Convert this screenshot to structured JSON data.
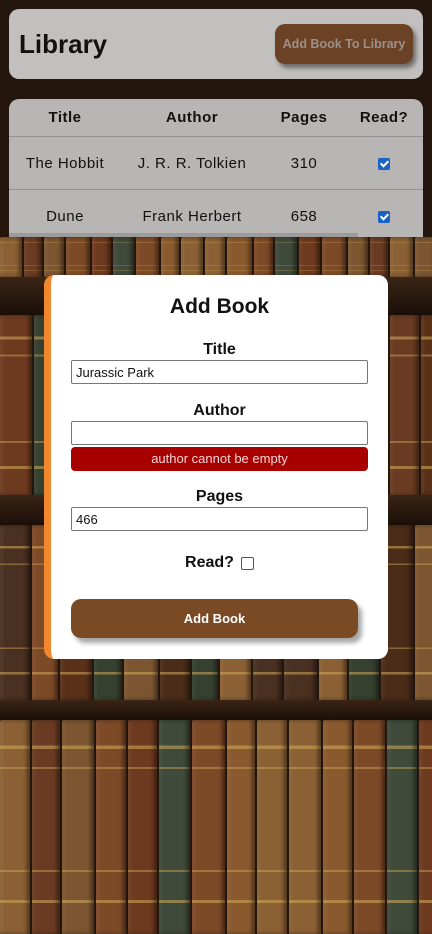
{
  "header": {
    "title": "Library",
    "add_button_label": "Add Book To Library"
  },
  "table": {
    "columns": [
      "Title",
      "Author",
      "Pages",
      "Read?"
    ],
    "rows": [
      {
        "title": "The Hobbit",
        "author": "J. R. R. Tolkien",
        "pages": "310",
        "read": true
      },
      {
        "title": "Dune",
        "author": "Frank Herbert",
        "pages": "658",
        "read": true
      }
    ]
  },
  "modal": {
    "title": "Add Book",
    "title_label": "Title",
    "title_value": "Jurassic Park",
    "author_label": "Author",
    "author_value": "",
    "author_error": "author cannot be empty",
    "pages_label": "Pages",
    "pages_value": "466",
    "read_label": "Read?",
    "read_checked": false,
    "submit_label": "Add Book"
  },
  "colors": {
    "accent_border": "#f0872e",
    "button_brown": "#7a4a25",
    "error_red": "#a80000",
    "checkbox_blue": "#1a62c4"
  }
}
